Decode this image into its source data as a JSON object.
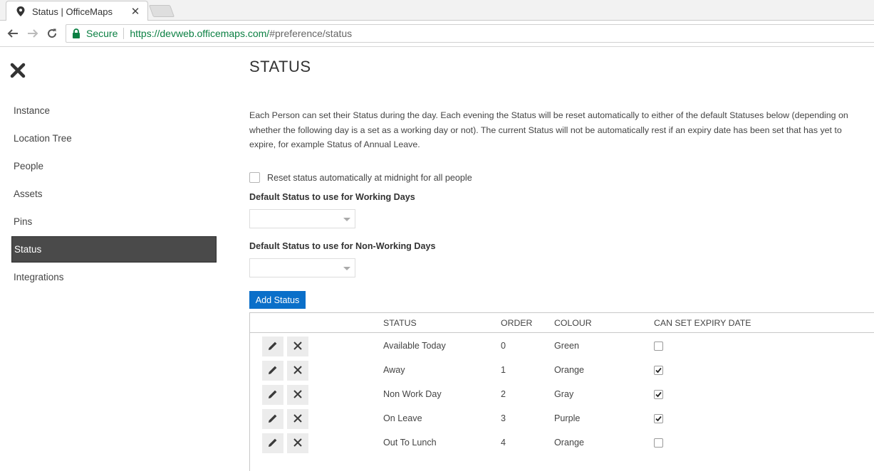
{
  "browser": {
    "tab_title": "Status | OfficeMaps",
    "secure_label": "Secure",
    "url_host": "https://devweb.officemaps.com/",
    "url_path": "#preference/status"
  },
  "sidebar": {
    "items": [
      {
        "label": "Instance",
        "active": false
      },
      {
        "label": "Location Tree",
        "active": false
      },
      {
        "label": "People",
        "active": false
      },
      {
        "label": "Assets",
        "active": false
      },
      {
        "label": "Pins",
        "active": false
      },
      {
        "label": "Status",
        "active": true
      },
      {
        "label": "Integrations",
        "active": false
      }
    ]
  },
  "main": {
    "title": "STATUS",
    "description": "Each Person can set their Status during the day. Each evening the Status will be reset automatically to either of the default Statuses below (depending on whether the following day is a set as a working day or not). The current Status will not be automatically rest if an expiry date has been set that has yet to expire, for example Status of Annual Leave.",
    "reset_checkbox_label": "Reset status automatically at midnight for all people",
    "reset_checked": false,
    "working_days_label": "Default Status to use for Working Days",
    "working_days_value": "",
    "non_working_days_label": "Default Status to use for Non-Working Days",
    "non_working_days_value": "",
    "add_button_label": "Add Status"
  },
  "table": {
    "headers": {
      "status": "STATUS",
      "order": "ORDER",
      "colour": "COLOUR",
      "expiry": "CAN SET EXPIRY DATE"
    },
    "rows": [
      {
        "status": "Available Today",
        "order": "0",
        "colour": "Green",
        "expiry": false
      },
      {
        "status": "Away",
        "order": "1",
        "colour": "Orange",
        "expiry": true
      },
      {
        "status": "Non Work Day",
        "order": "2",
        "colour": "Gray",
        "expiry": true
      },
      {
        "status": "On Leave",
        "order": "3",
        "colour": "Purple",
        "expiry": true
      },
      {
        "status": "Out To Lunch",
        "order": "4",
        "colour": "Orange",
        "expiry": false
      }
    ]
  },
  "icons": {
    "close": "close-icon",
    "edit": "pencil-icon",
    "delete": "x-icon"
  },
  "colors": {
    "primary_button": "#0a6fc9",
    "active_nav": "#4a4a4a",
    "secure_green": "#0b8043"
  }
}
